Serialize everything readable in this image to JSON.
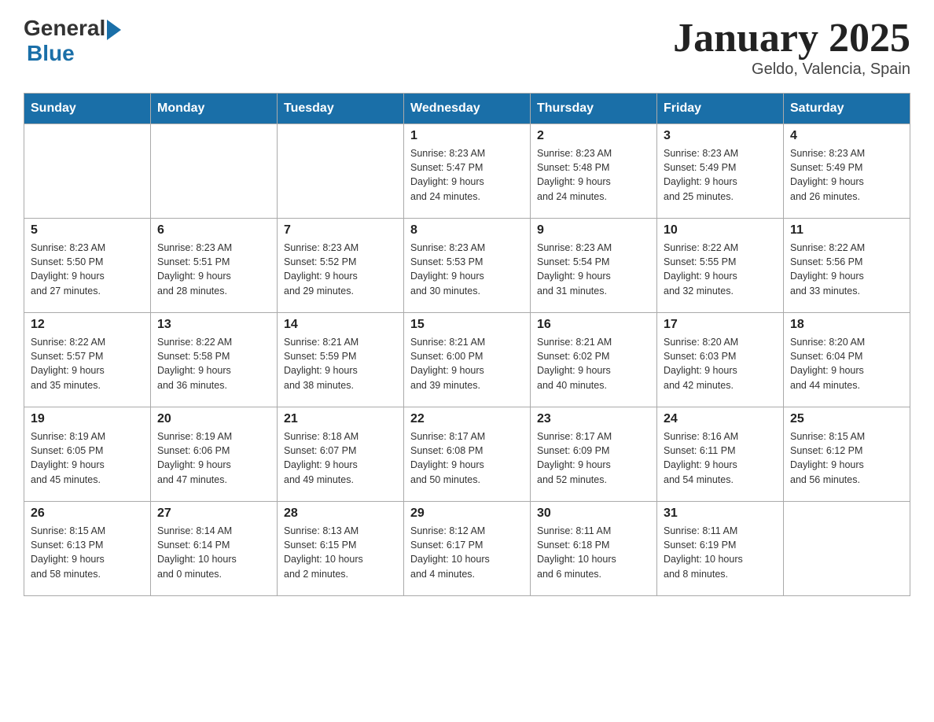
{
  "header": {
    "logo_general": "General",
    "logo_blue": "Blue",
    "title": "January 2025",
    "subtitle": "Geldo, Valencia, Spain"
  },
  "days_of_week": [
    "Sunday",
    "Monday",
    "Tuesday",
    "Wednesday",
    "Thursday",
    "Friday",
    "Saturday"
  ],
  "weeks": [
    [
      {
        "day": "",
        "info": ""
      },
      {
        "day": "",
        "info": ""
      },
      {
        "day": "",
        "info": ""
      },
      {
        "day": "1",
        "info": "Sunrise: 8:23 AM\nSunset: 5:47 PM\nDaylight: 9 hours\nand 24 minutes."
      },
      {
        "day": "2",
        "info": "Sunrise: 8:23 AM\nSunset: 5:48 PM\nDaylight: 9 hours\nand 24 minutes."
      },
      {
        "day": "3",
        "info": "Sunrise: 8:23 AM\nSunset: 5:49 PM\nDaylight: 9 hours\nand 25 minutes."
      },
      {
        "day": "4",
        "info": "Sunrise: 8:23 AM\nSunset: 5:49 PM\nDaylight: 9 hours\nand 26 minutes."
      }
    ],
    [
      {
        "day": "5",
        "info": "Sunrise: 8:23 AM\nSunset: 5:50 PM\nDaylight: 9 hours\nand 27 minutes."
      },
      {
        "day": "6",
        "info": "Sunrise: 8:23 AM\nSunset: 5:51 PM\nDaylight: 9 hours\nand 28 minutes."
      },
      {
        "day": "7",
        "info": "Sunrise: 8:23 AM\nSunset: 5:52 PM\nDaylight: 9 hours\nand 29 minutes."
      },
      {
        "day": "8",
        "info": "Sunrise: 8:23 AM\nSunset: 5:53 PM\nDaylight: 9 hours\nand 30 minutes."
      },
      {
        "day": "9",
        "info": "Sunrise: 8:23 AM\nSunset: 5:54 PM\nDaylight: 9 hours\nand 31 minutes."
      },
      {
        "day": "10",
        "info": "Sunrise: 8:22 AM\nSunset: 5:55 PM\nDaylight: 9 hours\nand 32 minutes."
      },
      {
        "day": "11",
        "info": "Sunrise: 8:22 AM\nSunset: 5:56 PM\nDaylight: 9 hours\nand 33 minutes."
      }
    ],
    [
      {
        "day": "12",
        "info": "Sunrise: 8:22 AM\nSunset: 5:57 PM\nDaylight: 9 hours\nand 35 minutes."
      },
      {
        "day": "13",
        "info": "Sunrise: 8:22 AM\nSunset: 5:58 PM\nDaylight: 9 hours\nand 36 minutes."
      },
      {
        "day": "14",
        "info": "Sunrise: 8:21 AM\nSunset: 5:59 PM\nDaylight: 9 hours\nand 38 minutes."
      },
      {
        "day": "15",
        "info": "Sunrise: 8:21 AM\nSunset: 6:00 PM\nDaylight: 9 hours\nand 39 minutes."
      },
      {
        "day": "16",
        "info": "Sunrise: 8:21 AM\nSunset: 6:02 PM\nDaylight: 9 hours\nand 40 minutes."
      },
      {
        "day": "17",
        "info": "Sunrise: 8:20 AM\nSunset: 6:03 PM\nDaylight: 9 hours\nand 42 minutes."
      },
      {
        "day": "18",
        "info": "Sunrise: 8:20 AM\nSunset: 6:04 PM\nDaylight: 9 hours\nand 44 minutes."
      }
    ],
    [
      {
        "day": "19",
        "info": "Sunrise: 8:19 AM\nSunset: 6:05 PM\nDaylight: 9 hours\nand 45 minutes."
      },
      {
        "day": "20",
        "info": "Sunrise: 8:19 AM\nSunset: 6:06 PM\nDaylight: 9 hours\nand 47 minutes."
      },
      {
        "day": "21",
        "info": "Sunrise: 8:18 AM\nSunset: 6:07 PM\nDaylight: 9 hours\nand 49 minutes."
      },
      {
        "day": "22",
        "info": "Sunrise: 8:17 AM\nSunset: 6:08 PM\nDaylight: 9 hours\nand 50 minutes."
      },
      {
        "day": "23",
        "info": "Sunrise: 8:17 AM\nSunset: 6:09 PM\nDaylight: 9 hours\nand 52 minutes."
      },
      {
        "day": "24",
        "info": "Sunrise: 8:16 AM\nSunset: 6:11 PM\nDaylight: 9 hours\nand 54 minutes."
      },
      {
        "day": "25",
        "info": "Sunrise: 8:15 AM\nSunset: 6:12 PM\nDaylight: 9 hours\nand 56 minutes."
      }
    ],
    [
      {
        "day": "26",
        "info": "Sunrise: 8:15 AM\nSunset: 6:13 PM\nDaylight: 9 hours\nand 58 minutes."
      },
      {
        "day": "27",
        "info": "Sunrise: 8:14 AM\nSunset: 6:14 PM\nDaylight: 10 hours\nand 0 minutes."
      },
      {
        "day": "28",
        "info": "Sunrise: 8:13 AM\nSunset: 6:15 PM\nDaylight: 10 hours\nand 2 minutes."
      },
      {
        "day": "29",
        "info": "Sunrise: 8:12 AM\nSunset: 6:17 PM\nDaylight: 10 hours\nand 4 minutes."
      },
      {
        "day": "30",
        "info": "Sunrise: 8:11 AM\nSunset: 6:18 PM\nDaylight: 10 hours\nand 6 minutes."
      },
      {
        "day": "31",
        "info": "Sunrise: 8:11 AM\nSunset: 6:19 PM\nDaylight: 10 hours\nand 8 minutes."
      },
      {
        "day": "",
        "info": ""
      }
    ]
  ]
}
